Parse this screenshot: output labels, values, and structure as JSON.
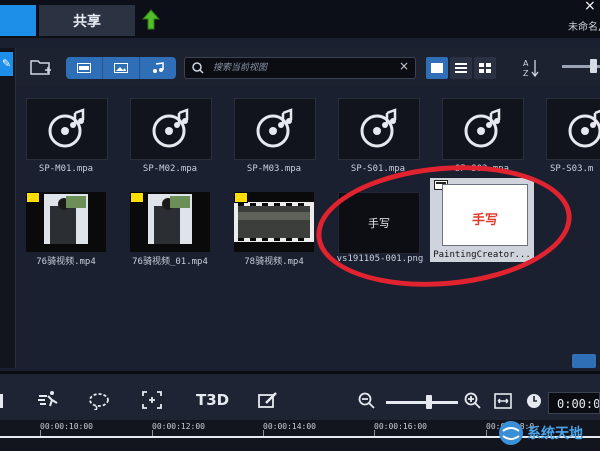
{
  "header": {
    "share_tab": "共享",
    "project_name": "未命名,",
    "close_glyph": "×"
  },
  "library": {
    "search_placeholder": "搜索当前视图",
    "clear_glyph": "×",
    "row1": [
      {
        "label": "SP-M01.mpa",
        "icon": "audio-disc-icon"
      },
      {
        "label": "SP-M02.mpa",
        "icon": "audio-disc-icon"
      },
      {
        "label": "SP-M03.mpa",
        "icon": "audio-disc-icon"
      },
      {
        "label": "SP-S01.mpa",
        "icon": "audio-disc-icon"
      },
      {
        "label": "SP-S02.mpa",
        "icon": "audio-disc-icon"
      },
      {
        "label": "SP-S03.m",
        "icon": "audio-disc-icon"
      }
    ],
    "row2": [
      {
        "label": "76骑视频.mp4",
        "icon": "video-icon"
      },
      {
        "label": "76骑视频_01.mp4",
        "icon": "video-icon"
      },
      {
        "label": "78骑视频.mp4",
        "icon": "video-icon"
      },
      {
        "label": "vs191105-001.png",
        "icon": "image-icon",
        "thumb_text": "手写"
      },
      {
        "label": "PaintingCreator...",
        "icon": "painting-icon",
        "thumb_text": "手写",
        "selected": true
      }
    ]
  },
  "timeline": {
    "timecode": "0:00:0",
    "ruler_labels": [
      "00:00:10:00",
      "00:00:12:00",
      "00:00:14:00",
      "00:00:16:00",
      "00:00:18:0"
    ],
    "title_tool_label": "T3D"
  },
  "watermark": {
    "text": "系统天地"
  },
  "colors": {
    "accent": "#1e8fe8",
    "highlight_circle": "#e0232f",
    "selected_thumb_text": "#e03b2a"
  }
}
